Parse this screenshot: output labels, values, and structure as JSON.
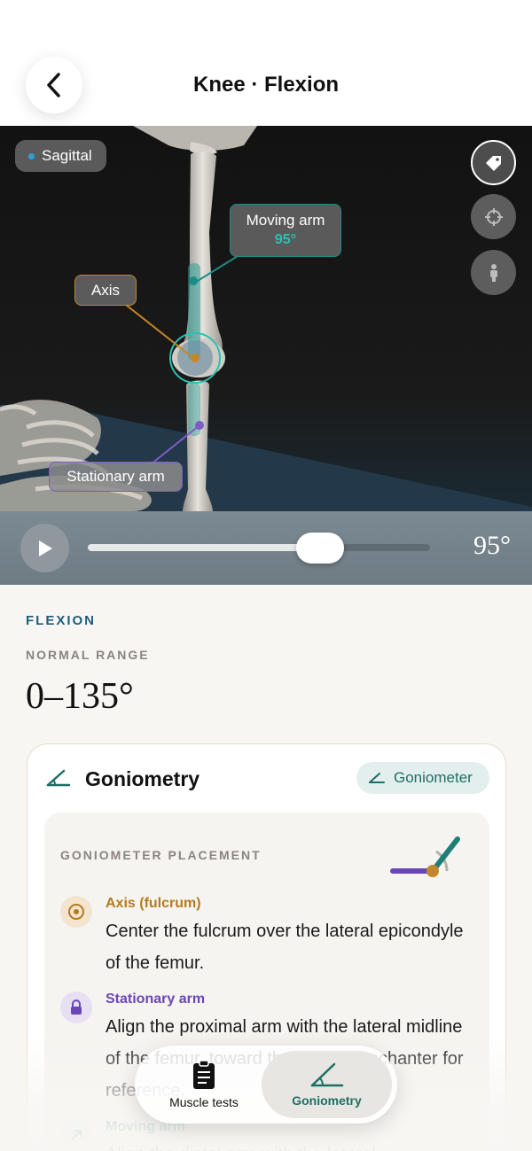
{
  "header": {
    "title": "Knee · Flexion",
    "back_icon": "chevron-left-icon"
  },
  "viewer": {
    "plane": "Sagittal",
    "plane_dot_color": "#2aa0d8",
    "side_buttons": [
      {
        "icon": "tag-icon",
        "active": true
      },
      {
        "icon": "crosshair-icon",
        "active": false
      },
      {
        "icon": "person-icon",
        "active": false
      }
    ],
    "callouts": {
      "moving_label": "Moving arm",
      "moving_value": "95°",
      "axis_label": "Axis",
      "stationary_label": "Stationary arm"
    },
    "colors": {
      "moving": "#1c8b84",
      "axis": "#c4862a",
      "stationary": "#7d5cc7"
    }
  },
  "playback": {
    "angle": "95°",
    "progress": 0.68,
    "play_icon": "play-icon"
  },
  "motion": {
    "kicker": "FLEXION",
    "normal_range_label": "NORMAL RANGE",
    "normal_range_value": "0–135°"
  },
  "card": {
    "title": "Goniometry",
    "pill_label": "Goniometer",
    "placement_label": "GONIOMETER PLACEMENT",
    "steps": [
      {
        "title": "Axis (fulcrum)",
        "text": "Center the fulcrum over the lateral epicondyle of the femur.",
        "color": "#b57a1c",
        "icon": "target-icon"
      },
      {
        "title": "Stationary arm",
        "text": "Align the proximal arm with the lateral midline of the femur, toward the greater trochanter for reference.",
        "color": "#6b46b8",
        "icon": "lock-icon"
      },
      {
        "title": "Moving arm",
        "text": "Align the distal arm with the lateral",
        "color": "#1d7f75",
        "icon": "arrow-up-right-icon"
      }
    ]
  },
  "tabbar": {
    "tabs": [
      {
        "label": "Muscle tests",
        "icon": "clipboard-icon",
        "selected": false
      },
      {
        "label": "Goniometry",
        "icon": "angle-icon",
        "selected": true
      }
    ]
  }
}
